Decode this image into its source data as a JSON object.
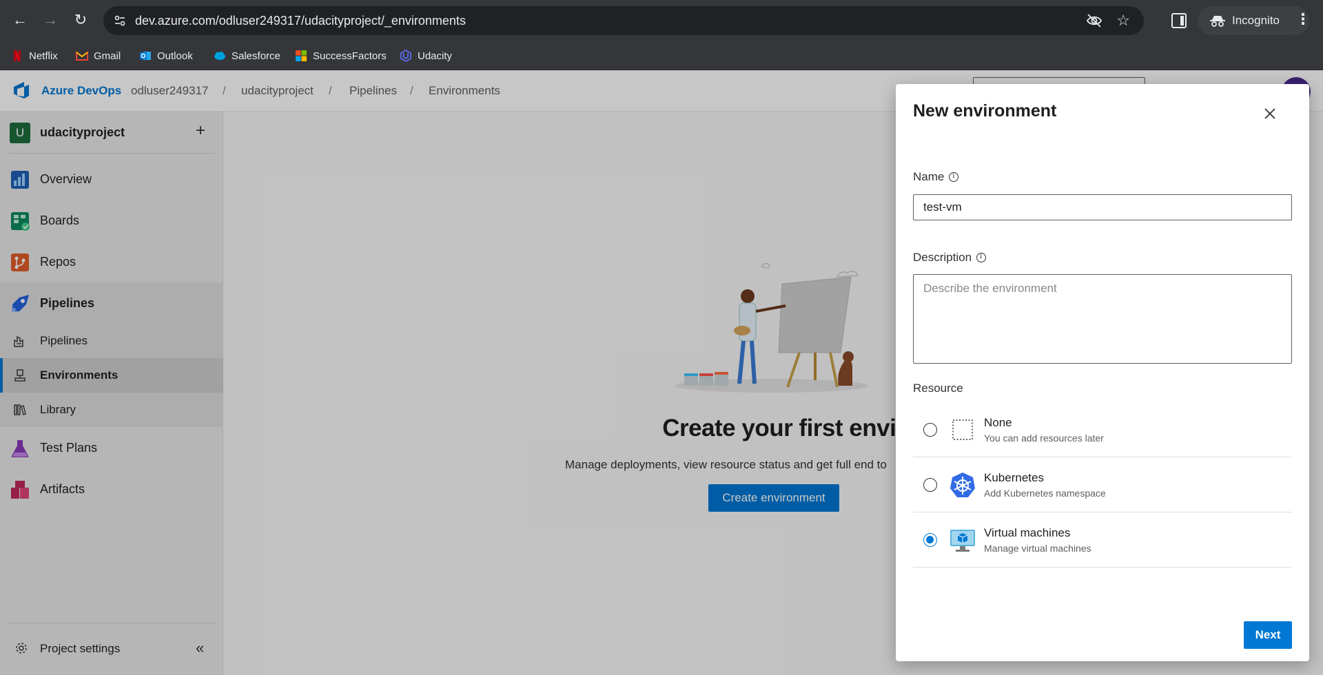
{
  "browser": {
    "url": "dev.azure.com/odluser249317/udacityproject/_environments",
    "profile_label": "Incognito",
    "bookmarks": [
      {
        "label": "Netflix",
        "icon": "netflix-icon",
        "color": "#e50914"
      },
      {
        "label": "Gmail",
        "icon": "gmail-icon",
        "color": "#ea4335"
      },
      {
        "label": "Outlook",
        "icon": "outlook-icon",
        "color": "#0078d4"
      },
      {
        "label": "Salesforce",
        "icon": "salesforce-cloud-icon",
        "color": "#00a1e0"
      },
      {
        "label": "SuccessFactors",
        "icon": "microsoft-grid-icon",
        "color": "#f25022"
      },
      {
        "label": "Udacity",
        "icon": "udacity-icon",
        "color": "#02b3e4"
      }
    ]
  },
  "header": {
    "brand": "Azure DevOps",
    "breadcrumbs": [
      "odluser249317",
      "udacityproject",
      "Pipelines",
      "Environments"
    ]
  },
  "sidebar": {
    "project_initial": "U",
    "project_name": "udacityproject",
    "items": [
      {
        "label": "Overview",
        "icon": "overview-icon"
      },
      {
        "label": "Boards",
        "icon": "boards-icon"
      },
      {
        "label": "Repos",
        "icon": "repos-icon"
      },
      {
        "label": "Pipelines",
        "icon": "pipelines-icon"
      },
      {
        "label": "Test Plans",
        "icon": "test-plans-icon"
      },
      {
        "label": "Artifacts",
        "icon": "artifacts-icon"
      }
    ],
    "sub_items": [
      {
        "label": "Pipelines",
        "icon": "pipelines-sub-icon"
      },
      {
        "label": "Environments",
        "icon": "environments-icon",
        "selected": true
      },
      {
        "label": "Library",
        "icon": "library-icon"
      }
    ],
    "settings_label": "Project settings"
  },
  "main": {
    "title": "Create your first environment",
    "subtitle": "Manage deployments, view resource status and get full end to",
    "create_button": "Create environment"
  },
  "dialog": {
    "title": "New environment",
    "name_label": "Name",
    "name_value": "test-vm",
    "description_label": "Description",
    "description_placeholder": "Describe the environment",
    "resource_label": "Resource",
    "resources": [
      {
        "name": "None",
        "description": "You can add resources later",
        "icon": "none-dashed-box-icon",
        "selected": false
      },
      {
        "name": "Kubernetes",
        "description": "Add Kubernetes namespace",
        "icon": "kubernetes-icon",
        "selected": false
      },
      {
        "name": "Virtual machines",
        "description": "Manage virtual machines",
        "icon": "virtual-machine-icon",
        "selected": true
      }
    ],
    "next_button": "Next"
  },
  "colors": {
    "accent": "#0078d4",
    "chrome_bg": "#35363a",
    "project_badge": "#1e6e3d"
  }
}
